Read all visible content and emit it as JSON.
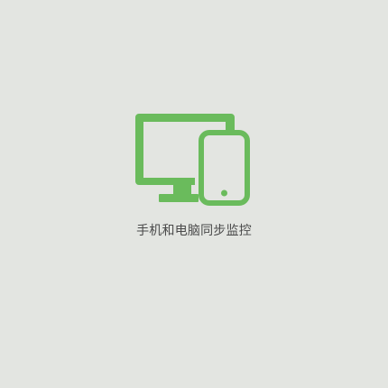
{
  "feature": {
    "icon": "desktop-and-phone-icon",
    "label": "手机和电脑同步监控"
  },
  "colors": {
    "background": "#e3e5e1",
    "accent": "#6abb5c",
    "label_text": "#4a4a4a"
  }
}
